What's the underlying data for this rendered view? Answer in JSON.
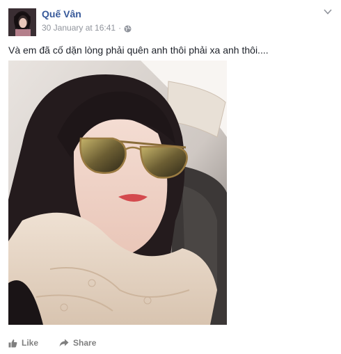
{
  "post": {
    "author": "Quế Vân",
    "timestamp": "30 January at 16:41",
    "separator": "·",
    "privacy_icon": "globe-icon",
    "options_icon": "chevron-down-icon",
    "text": "Và em đã cố dặn lòng phải quên anh thôi phải xa anh thôi....",
    "actions": {
      "like_label": "Like",
      "share_label": "Share"
    }
  },
  "colors": {
    "author_link": "#365899",
    "meta_text": "#90949c",
    "action_text": "#7f7f7f"
  }
}
